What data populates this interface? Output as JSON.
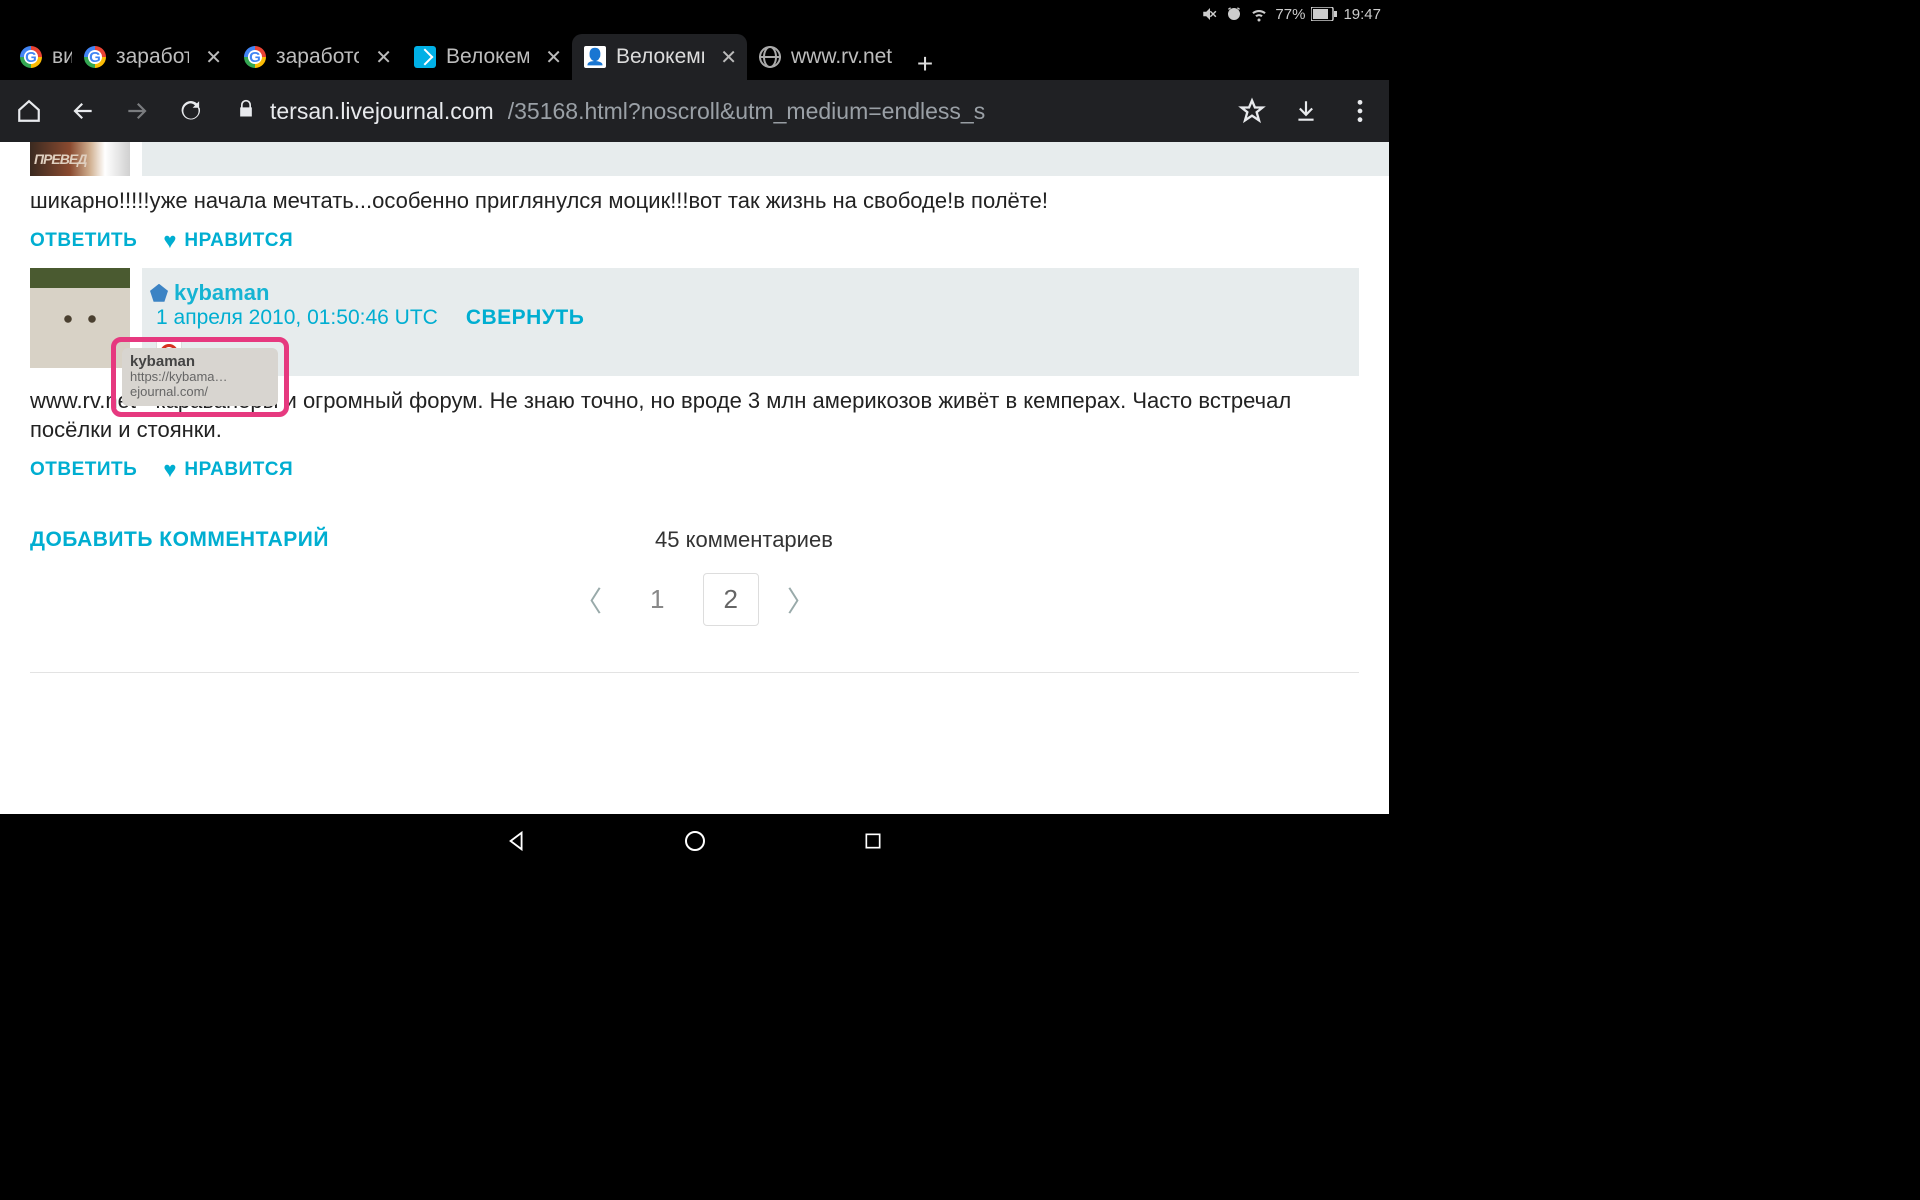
{
  "status": {
    "battery": "77%",
    "time": "19:47"
  },
  "tabs": [
    {
      "title": "вид"
    },
    {
      "title": "заработок ви"
    },
    {
      "title": "заработок бл"
    },
    {
      "title": "Велокемпер"
    },
    {
      "title": "Велокемпер"
    },
    {
      "title": "www.rv.net"
    }
  ],
  "url": {
    "host": "tersan.livejournal.com",
    "path": "/35168.html?noscroll&utm_medium=endless_s"
  },
  "partial_avatar_text": "ПРЕВЕД",
  "comment1": {
    "body": "шикарно!!!!!уже начала мечтать...особенно приглянулся моцик!!!вот так жизнь на свободе!в полёте!",
    "reply": "ОТВЕТИТЬ",
    "like": "НРАВИТСЯ"
  },
  "tooltip": {
    "title": "kybaman",
    "url": "https://kybama…ejournal.com/"
  },
  "comment2": {
    "username": "kybaman",
    "timestamp": "1 апреля 2010, 01:50:46 UTC",
    "collapse": "СВЕРНУТЬ",
    "body": "www.rv.net - караванеры и огромный форум. Не знаю точно, но вроде 3 млн америкозов живёт в кемперах. Часто встречал посёлки и стоянки.",
    "reply": "ОТВЕТИТЬ",
    "like": "НРАВИТСЯ"
  },
  "footer": {
    "add": "ДОБАВИТЬ КОММЕНТАРИЙ",
    "count": "45 комментариев"
  },
  "pager": {
    "page1": "1",
    "page2": "2"
  }
}
